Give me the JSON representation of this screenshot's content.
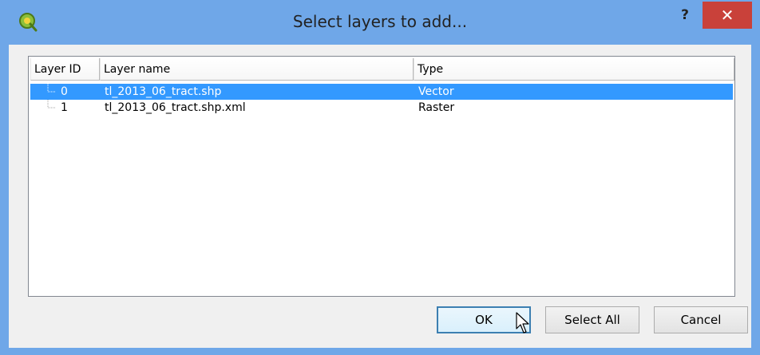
{
  "window": {
    "title": "Select layers to add...",
    "help_label": "?",
    "close_label": "✕"
  },
  "table": {
    "columns": [
      "Layer ID",
      "Layer name",
      "Type"
    ],
    "rows": [
      {
        "id": "0",
        "name": "tl_2013_06_tract.shp",
        "type": "Vector",
        "selected": true
      },
      {
        "id": "1",
        "name": "tl_2013_06_tract.shp.xml",
        "type": "Raster",
        "selected": false
      }
    ]
  },
  "buttons": {
    "ok": "OK",
    "select_all": "Select All",
    "cancel": "Cancel"
  },
  "colors": {
    "titlebar": "#6fa7e8",
    "close": "#c9413a",
    "selection": "#3399ff"
  },
  "icons": {
    "app": "qgis-icon",
    "cursor": "mouse-pointer-icon"
  }
}
